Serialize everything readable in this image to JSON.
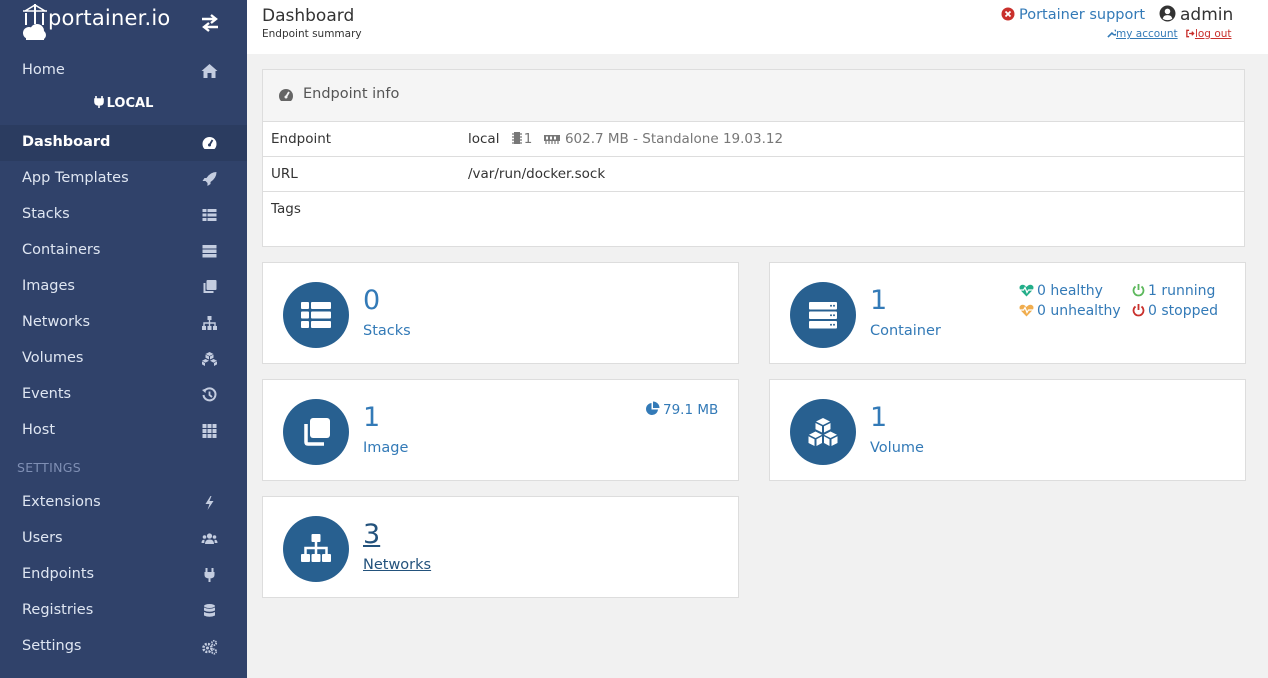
{
  "brand": {
    "name": "portainer.io"
  },
  "sidebar": {
    "items": [
      {
        "label": "Home",
        "icon": "home-icon"
      },
      {
        "label": "Dashboard",
        "icon": "tachometer-icon",
        "active": true
      },
      {
        "label": "App Templates",
        "icon": "rocket-icon"
      },
      {
        "label": "Stacks",
        "icon": "th-list-icon"
      },
      {
        "label": "Containers",
        "icon": "server-icon"
      },
      {
        "label": "Images",
        "icon": "clone-icon"
      },
      {
        "label": "Networks",
        "icon": "sitemap-icon"
      },
      {
        "label": "Volumes",
        "icon": "cubes-icon"
      },
      {
        "label": "Events",
        "icon": "history-icon"
      },
      {
        "label": "Host",
        "icon": "th-icon"
      },
      {
        "label": "Extensions",
        "icon": "bolt-icon"
      },
      {
        "label": "Users",
        "icon": "users-icon"
      },
      {
        "label": "Endpoints",
        "icon": "plug-icon"
      },
      {
        "label": "Registries",
        "icon": "database-icon"
      },
      {
        "label": "Settings",
        "icon": "cogs-icon"
      }
    ],
    "endpoint_label": "LOCAL",
    "settings_section": "SETTINGS"
  },
  "header": {
    "title": "Dashboard",
    "subtitle": "Endpoint summary",
    "support": "Portainer support",
    "user": "admin",
    "my_account": "my account",
    "log_out": "log out"
  },
  "endpoint_info": {
    "title": "Endpoint info",
    "rows": [
      {
        "key": "Endpoint",
        "name": "local",
        "cpu": "1",
        "memory": "602.7 MB - Standalone 19.03.12"
      },
      {
        "key": "URL",
        "value": "/var/run/docker.sock"
      },
      {
        "key": "Tags",
        "value": ""
      }
    ]
  },
  "widgets": {
    "stacks": {
      "count": "0",
      "label": "Stacks"
    },
    "containers": {
      "count": "1",
      "label": "Container",
      "healthy": "0 healthy",
      "unhealthy": "0 unhealthy",
      "running": "1 running",
      "stopped": "0 stopped"
    },
    "images": {
      "count": "1",
      "label": "Image",
      "size": "79.1 MB"
    },
    "volumes": {
      "count": "1",
      "label": "Volume"
    },
    "networks": {
      "count": "3",
      "label": "Networks"
    }
  },
  "colors": {
    "sidebar": "#30426a",
    "accent": "#337ab7",
    "widget_circle": "#286090",
    "healthy": "#23ae89",
    "unhealthy": "#f0ad4e",
    "running": "#5cb85c",
    "stopped": "#c9302c"
  }
}
